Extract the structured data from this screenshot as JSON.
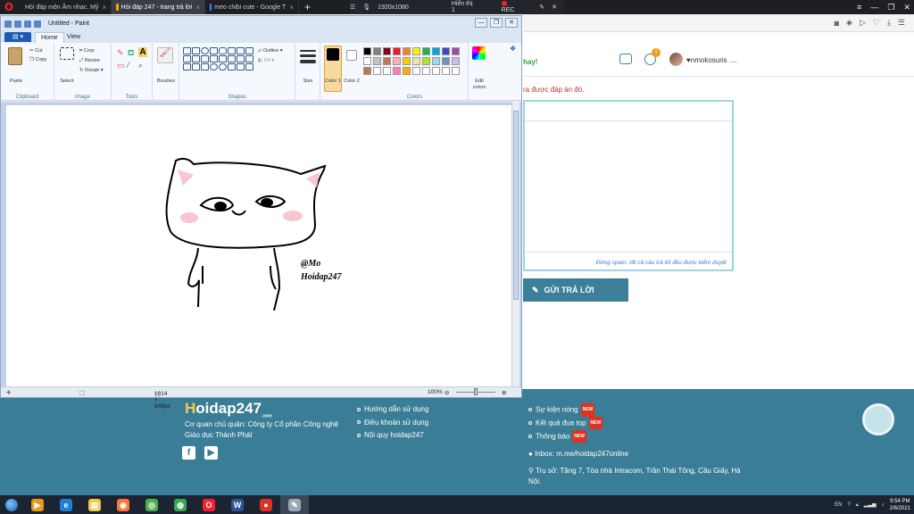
{
  "browser": {
    "tabs": [
      {
        "label": "Hỏi đáp môn Âm nhạc, Mỹ",
        "color": "#f7a700"
      },
      {
        "label": "Hỏi đáp 247 - trang trả lời",
        "color": "#f7a700",
        "active": true
      },
      {
        "label": "meo chibi cute - Google T",
        "color": "#4285f4"
      }
    ],
    "new_tab": "+",
    "recorder": {
      "resolution": "1920x1080",
      "display": "Hiển thị 1",
      "rec": "REC"
    }
  },
  "site": {
    "hay_text": "hay!",
    "notif_count": "1",
    "username": "♥nmokosuris ....",
    "answer_hint": "ra được đáp án đó.",
    "spam_note": "Đừng spam, tất cả câu trả lời đều được kiểm duyệt",
    "submit_label": "GỬI TRẢ LỜI",
    "footer": {
      "logo_h": "H",
      "logo_rest": "oidap247",
      "logo_sub": ".com",
      "owner": "Cơ quan chủ quản: Công ty Cổ phần Công nghệ Giáo dục Thành Phát",
      "links1": [
        "Hướng dẫn sử dụng",
        "Điều khoản sử dụng",
        "Nội quy hoidap247"
      ],
      "links2": [
        "Sự kiện nóng",
        "Kết quả đua top",
        "Thông báo"
      ],
      "new_badge": "NEW",
      "inbox": "Inbox: m.me/hoidap247online",
      "address": "Trụ sở: Tầng 7, Tòa nhà Intracom, Trần Thái Tông, Cầu Giấy, Hà Nội."
    }
  },
  "paint": {
    "title": "Untitled - Paint",
    "file_tab": "▤ ▾",
    "tabs": [
      "Home",
      "View"
    ],
    "ribbon": {
      "clipboard": {
        "label": "Clipboard",
        "paste": "Paste",
        "cut": "Cut",
        "copy": "Copy"
      },
      "image": {
        "label": "Image",
        "select": "Select",
        "crop": "Crop",
        "resize": "Resize",
        "rotate": "Rotate ▾"
      },
      "tools": {
        "label": "Tools"
      },
      "brushes": "Brushes",
      "shapes": {
        "label": "Shapes",
        "outline": "Outline ▾",
        "fill": "Fill ▾"
      },
      "size": "Size",
      "color1": "Color 1",
      "color2": "Color 2",
      "colors_label": "Colors",
      "edit_colors": "Edit colors"
    },
    "palette": [
      "#000000",
      "#7f7f7f",
      "#880015",
      "#ed1c24",
      "#ff7f27",
      "#fff200",
      "#22b14c",
      "#00a2e8",
      "#3f48cc",
      "#a349a4",
      "#ffffff",
      "#c3c3c3",
      "#b97a57",
      "#ffaec9",
      "#ffc90e",
      "#efe4b0",
      "#b5e61d",
      "#99d9ea",
      "#7092be",
      "#c8bfe7",
      "#b97a57",
      "#ffffff",
      "#ffffff",
      "#ff7fb0",
      "#ffae00",
      "#ffffff",
      "#ffffff",
      "#ffffff",
      "#ffffff",
      "#ffffff"
    ],
    "signature": [
      "@Mo",
      "Hoidap247"
    ],
    "status": {
      "size": "1014 × 848px",
      "zoom": "100%"
    }
  },
  "taskbar": {
    "apps": [
      {
        "name": "media-player",
        "color": "#e89a1a",
        "glyph": "▶"
      },
      {
        "name": "internet-explorer",
        "color": "#1f7fd6",
        "glyph": "e"
      },
      {
        "name": "file-explorer",
        "color": "#f2c94c",
        "glyph": "▤"
      },
      {
        "name": "firefox",
        "color": "#ff7139",
        "glyph": "◉"
      },
      {
        "name": "green-app",
        "color": "#4caf50",
        "glyph": "◎"
      },
      {
        "name": "chrome",
        "color": "#34a853",
        "glyph": "◍"
      },
      {
        "name": "opera",
        "color": "#ff1b2d",
        "glyph": "O"
      },
      {
        "name": "word",
        "color": "#2b579a",
        "glyph": "W"
      },
      {
        "name": "recorder",
        "color": "#d32",
        "glyph": "●"
      },
      {
        "name": "paint",
        "color": "#9aa7b8",
        "glyph": "✎"
      }
    ],
    "lang": "EN",
    "time": "9:54 PM",
    "date": "2/6/2021"
  }
}
